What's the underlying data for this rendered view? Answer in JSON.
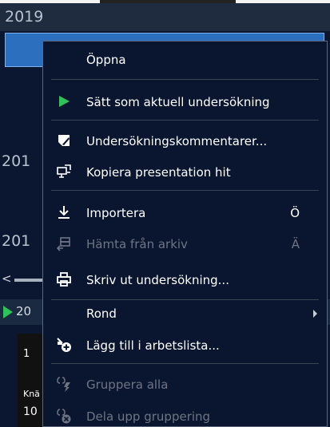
{
  "background": {
    "years": [
      "2019",
      "201",
      "201"
    ],
    "current_row_label": "20",
    "thumbnail": {
      "number": "1",
      "label": "Knä",
      "value": "10"
    }
  },
  "menu": {
    "items": [
      {
        "label": "Öppna",
        "icon": "none",
        "shortcut": "",
        "disabled": false
      },
      {
        "label": "Sätt som aktuell undersökning",
        "icon": "play-icon",
        "shortcut": "",
        "disabled": false
      },
      {
        "label": "Undersökningskommentarer...",
        "icon": "comment-edit-icon",
        "shortcut": "",
        "disabled": false
      },
      {
        "label": "Kopiera presentation hit",
        "icon": "copy-presentation-icon",
        "shortcut": "",
        "disabled": false
      },
      {
        "label": "Importera",
        "icon": "download-icon",
        "shortcut": "Ö",
        "disabled": false
      },
      {
        "label": "Hämta från arkiv",
        "icon": "archive-fetch-icon",
        "shortcut": "Ä",
        "disabled": true
      },
      {
        "label": "Skriv ut undersökning...",
        "icon": "printer-icon",
        "shortcut": "",
        "disabled": false
      },
      {
        "label": "Rond",
        "icon": "none",
        "shortcut": "",
        "disabled": false
      },
      {
        "label": "Lägg till i arbetslista...",
        "icon": "add-to-worklist-icon",
        "shortcut": "",
        "disabled": false
      },
      {
        "label": "Gruppera alla",
        "icon": "group-icon",
        "shortcut": "",
        "disabled": true
      },
      {
        "label": "Dela upp gruppering",
        "icon": "ungroup-icon",
        "shortcut": "",
        "disabled": true
      }
    ]
  },
  "colors": {
    "menu_bg": "#0a1630",
    "play_green": "#2fc25b",
    "disabled_text": "#6e7482",
    "selection_blue": "#2b6fbe"
  }
}
